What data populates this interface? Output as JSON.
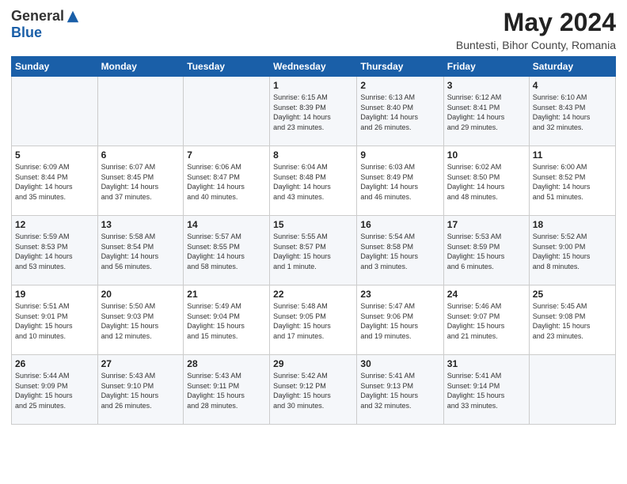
{
  "logo": {
    "general": "General",
    "blue": "Blue"
  },
  "title": "May 2024",
  "subtitle": "Buntesti, Bihor County, Romania",
  "days_of_week": [
    "Sunday",
    "Monday",
    "Tuesday",
    "Wednesday",
    "Thursday",
    "Friday",
    "Saturday"
  ],
  "weeks": [
    [
      {
        "day": "",
        "info": ""
      },
      {
        "day": "",
        "info": ""
      },
      {
        "day": "",
        "info": ""
      },
      {
        "day": "1",
        "info": "Sunrise: 6:15 AM\nSunset: 8:39 PM\nDaylight: 14 hours\nand 23 minutes."
      },
      {
        "day": "2",
        "info": "Sunrise: 6:13 AM\nSunset: 8:40 PM\nDaylight: 14 hours\nand 26 minutes."
      },
      {
        "day": "3",
        "info": "Sunrise: 6:12 AM\nSunset: 8:41 PM\nDaylight: 14 hours\nand 29 minutes."
      },
      {
        "day": "4",
        "info": "Sunrise: 6:10 AM\nSunset: 8:43 PM\nDaylight: 14 hours\nand 32 minutes."
      }
    ],
    [
      {
        "day": "5",
        "info": "Sunrise: 6:09 AM\nSunset: 8:44 PM\nDaylight: 14 hours\nand 35 minutes."
      },
      {
        "day": "6",
        "info": "Sunrise: 6:07 AM\nSunset: 8:45 PM\nDaylight: 14 hours\nand 37 minutes."
      },
      {
        "day": "7",
        "info": "Sunrise: 6:06 AM\nSunset: 8:47 PM\nDaylight: 14 hours\nand 40 minutes."
      },
      {
        "day": "8",
        "info": "Sunrise: 6:04 AM\nSunset: 8:48 PM\nDaylight: 14 hours\nand 43 minutes."
      },
      {
        "day": "9",
        "info": "Sunrise: 6:03 AM\nSunset: 8:49 PM\nDaylight: 14 hours\nand 46 minutes."
      },
      {
        "day": "10",
        "info": "Sunrise: 6:02 AM\nSunset: 8:50 PM\nDaylight: 14 hours\nand 48 minutes."
      },
      {
        "day": "11",
        "info": "Sunrise: 6:00 AM\nSunset: 8:52 PM\nDaylight: 14 hours\nand 51 minutes."
      }
    ],
    [
      {
        "day": "12",
        "info": "Sunrise: 5:59 AM\nSunset: 8:53 PM\nDaylight: 14 hours\nand 53 minutes."
      },
      {
        "day": "13",
        "info": "Sunrise: 5:58 AM\nSunset: 8:54 PM\nDaylight: 14 hours\nand 56 minutes."
      },
      {
        "day": "14",
        "info": "Sunrise: 5:57 AM\nSunset: 8:55 PM\nDaylight: 14 hours\nand 58 minutes."
      },
      {
        "day": "15",
        "info": "Sunrise: 5:55 AM\nSunset: 8:57 PM\nDaylight: 15 hours\nand 1 minute."
      },
      {
        "day": "16",
        "info": "Sunrise: 5:54 AM\nSunset: 8:58 PM\nDaylight: 15 hours\nand 3 minutes."
      },
      {
        "day": "17",
        "info": "Sunrise: 5:53 AM\nSunset: 8:59 PM\nDaylight: 15 hours\nand 6 minutes."
      },
      {
        "day": "18",
        "info": "Sunrise: 5:52 AM\nSunset: 9:00 PM\nDaylight: 15 hours\nand 8 minutes."
      }
    ],
    [
      {
        "day": "19",
        "info": "Sunrise: 5:51 AM\nSunset: 9:01 PM\nDaylight: 15 hours\nand 10 minutes."
      },
      {
        "day": "20",
        "info": "Sunrise: 5:50 AM\nSunset: 9:03 PM\nDaylight: 15 hours\nand 12 minutes."
      },
      {
        "day": "21",
        "info": "Sunrise: 5:49 AM\nSunset: 9:04 PM\nDaylight: 15 hours\nand 15 minutes."
      },
      {
        "day": "22",
        "info": "Sunrise: 5:48 AM\nSunset: 9:05 PM\nDaylight: 15 hours\nand 17 minutes."
      },
      {
        "day": "23",
        "info": "Sunrise: 5:47 AM\nSunset: 9:06 PM\nDaylight: 15 hours\nand 19 minutes."
      },
      {
        "day": "24",
        "info": "Sunrise: 5:46 AM\nSunset: 9:07 PM\nDaylight: 15 hours\nand 21 minutes."
      },
      {
        "day": "25",
        "info": "Sunrise: 5:45 AM\nSunset: 9:08 PM\nDaylight: 15 hours\nand 23 minutes."
      }
    ],
    [
      {
        "day": "26",
        "info": "Sunrise: 5:44 AM\nSunset: 9:09 PM\nDaylight: 15 hours\nand 25 minutes."
      },
      {
        "day": "27",
        "info": "Sunrise: 5:43 AM\nSunset: 9:10 PM\nDaylight: 15 hours\nand 26 minutes."
      },
      {
        "day": "28",
        "info": "Sunrise: 5:43 AM\nSunset: 9:11 PM\nDaylight: 15 hours\nand 28 minutes."
      },
      {
        "day": "29",
        "info": "Sunrise: 5:42 AM\nSunset: 9:12 PM\nDaylight: 15 hours\nand 30 minutes."
      },
      {
        "day": "30",
        "info": "Sunrise: 5:41 AM\nSunset: 9:13 PM\nDaylight: 15 hours\nand 32 minutes."
      },
      {
        "day": "31",
        "info": "Sunrise: 5:41 AM\nSunset: 9:14 PM\nDaylight: 15 hours\nand 33 minutes."
      },
      {
        "day": "",
        "info": ""
      }
    ]
  ]
}
